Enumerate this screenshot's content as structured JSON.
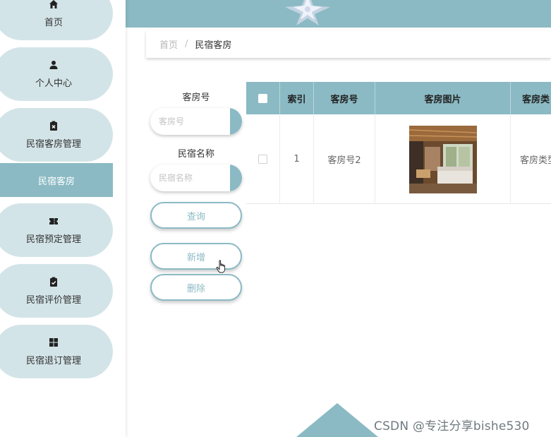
{
  "sidebar": {
    "items": [
      {
        "label": "首页",
        "icon": "home-icon"
      },
      {
        "label": "个人中心",
        "icon": "user-icon"
      },
      {
        "label": "民宿客房管理",
        "icon": "clipboard-x-icon"
      },
      {
        "label": "民宿客房",
        "active": true
      },
      {
        "label": "民宿预定管理",
        "icon": "ticket-icon"
      },
      {
        "label": "民宿评价管理",
        "icon": "clipboard-check-icon"
      },
      {
        "label": "民宿退订管理",
        "icon": "grid-icon"
      }
    ]
  },
  "breadcrumb": {
    "home": "首页",
    "separator": "/",
    "current": "民宿客房"
  },
  "search": {
    "room_no_label": "客房号",
    "room_no_placeholder": "客房号",
    "name_label": "民宿名称",
    "name_placeholder": "民宿名称",
    "query_button": "查询",
    "add_button": "新增",
    "delete_button": "删除"
  },
  "table": {
    "columns": [
      "索引",
      "客房号",
      "客房图片",
      "客房类"
    ],
    "rows": [
      {
        "index": "1",
        "room_no": "客房号2",
        "image": "room-photo",
        "room_type": "客房类型"
      }
    ]
  },
  "watermark": "CSDN @专注分享bishe530",
  "colors": {
    "accent": "#8bbac4",
    "sidebar_pill": "#d3e4e8"
  }
}
